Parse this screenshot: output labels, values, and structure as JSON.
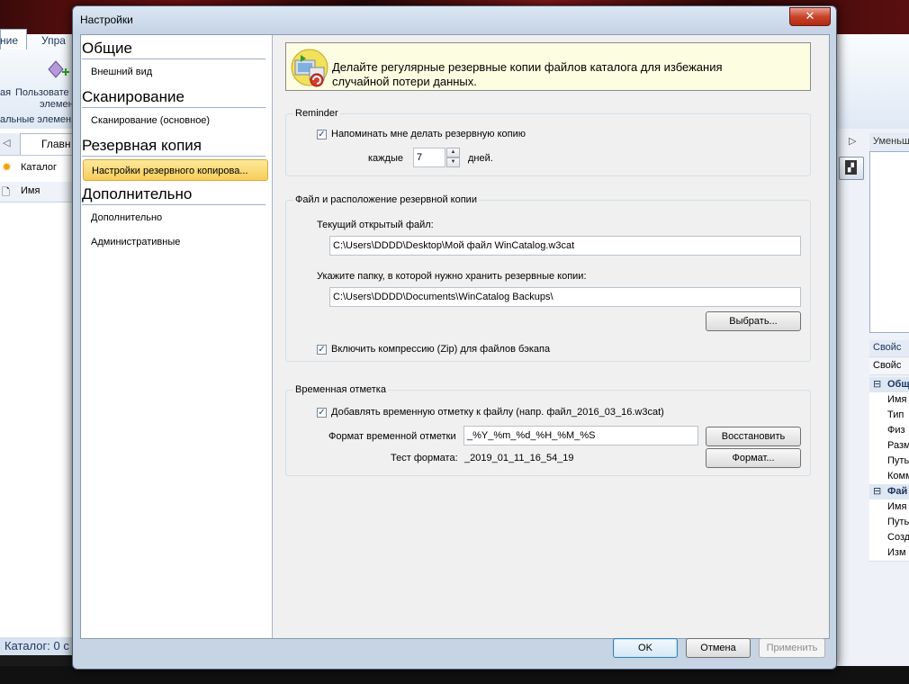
{
  "background": {
    "tabs": [
      "ние",
      "Упра"
    ],
    "ribbon_labels": [
      "ая",
      "Пользовате",
      "элемен",
      "альные элемен"
    ],
    "nav_tab": "Главн",
    "tree_item": "Каталог",
    "column": "Имя",
    "status": "Каталог: 0 с",
    "right_header": "Уменьш",
    "right_props_header1": "Свойс",
    "right_props_header2": "Свойс",
    "prop_rows": [
      "Общ",
      "Имя",
      "Тип",
      "Физ",
      "Разм",
      "Путь",
      "Комм",
      "Фай",
      "Имя",
      "Путь",
      "Созд",
      "Изм"
    ]
  },
  "dialog": {
    "title": "Настройки",
    "close_label": "✕",
    "sidebar": {
      "categories": [
        {
          "header": "Общие",
          "items": [
            "Внешний вид"
          ]
        },
        {
          "header": "Сканирование",
          "items": [
            "Сканирование (основное)"
          ]
        },
        {
          "header": "Резервная копия",
          "items": [
            "Настройки резервного копирова..."
          ]
        },
        {
          "header": "Дополнительно",
          "items": [
            "Дополнительно",
            "Административные"
          ]
        }
      ],
      "selected": "Настройки резервного копирова..."
    },
    "banner": {
      "text": "Делайте регулярные резервные копии файлов каталога для избежания случайной потери данных."
    },
    "reminder": {
      "title": "Reminder",
      "remind_checked": true,
      "remind_label": "Напоминать мне делать резервную копию",
      "every_label": "каждые",
      "days_value": "7",
      "days_label": "дней."
    },
    "file_location": {
      "title": "Файл и расположение резервной копии",
      "current_label": "Текущий открытый файл:",
      "current_value": "C:\\Users\\DDDD\\Desktop\\Мой файл WinCatalog.w3cat",
      "folder_label": "Укажите папку, в которой нужно хранить резервные копии:",
      "folder_value": "C:\\Users\\DDDD\\Documents\\WinCatalog Backups\\",
      "browse_label": "Выбрать...",
      "zip_checked": true,
      "zip_label": "Включить компрессию (Zip) для файлов бэкапа"
    },
    "timestamp": {
      "title": "Временная отметка",
      "add_checked": true,
      "add_label": "Добавлять временную отметку к файлу (напр. файл_2016_03_16.w3cat)",
      "format_label": "Формат временной отметки",
      "format_value": "_%Y_%m_%d_%H_%M_%S",
      "restore_label": "Восстановить",
      "test_label": "Тест формата:",
      "test_value": "_2019_01_11_16_54_19",
      "format_button": "Формат..."
    },
    "footer": {
      "ok": "OK",
      "cancel": "Отмена",
      "apply": "Применить"
    }
  }
}
